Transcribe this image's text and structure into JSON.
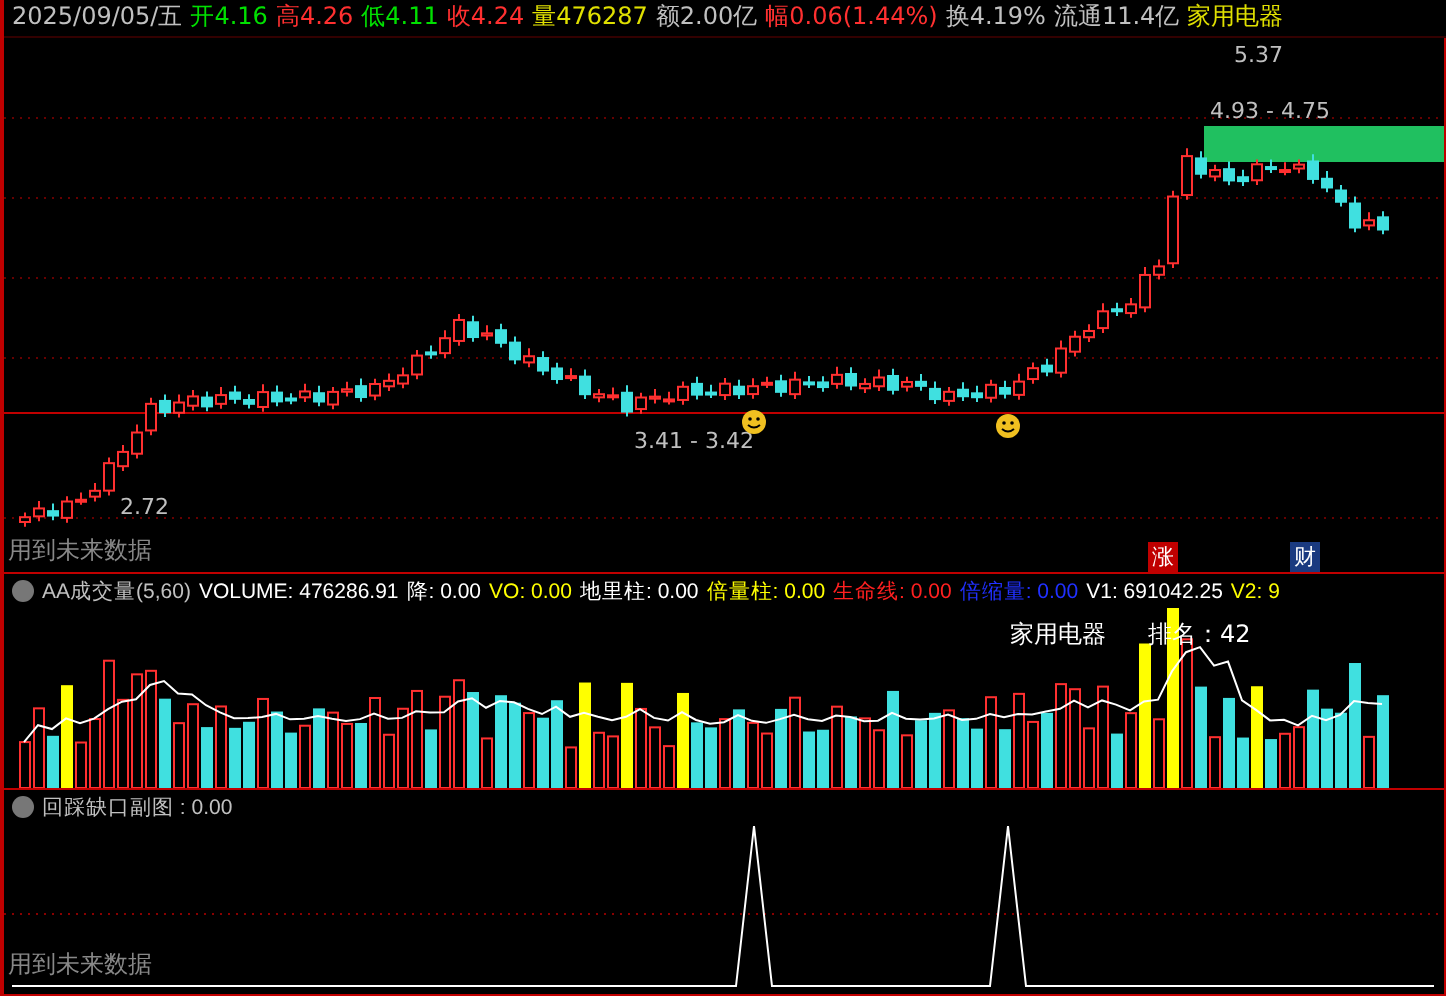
{
  "header": {
    "date": "2025/09/05/五",
    "fields": [
      {
        "label": "开",
        "value": "4.16",
        "color": "#00e000"
      },
      {
        "label": "高",
        "value": "4.26",
        "color": "#ff3030"
      },
      {
        "label": "低",
        "value": "4.11",
        "color": "#00e000"
      },
      {
        "label": "收",
        "value": "4.24",
        "color": "#ff3030"
      },
      {
        "label": "量",
        "value": "476287",
        "color": "#e0e000"
      },
      {
        "label": "额",
        "value": "2.00亿",
        "color": "#c0c0c0"
      },
      {
        "label": "幅",
        "value": "0.06(1.44%)",
        "color": "#ff3030"
      },
      {
        "label": "换",
        "value": "4.19%",
        "color": "#c0c0c0"
      },
      {
        "label": "流通",
        "value": "11.4亿",
        "color": "#c0c0c0"
      }
    ],
    "sector": "家用电器"
  },
  "main_chart": {
    "high_label": "5.37",
    "zone_label": "4.93 - 4.75",
    "support_label": "3.41 - 3.42",
    "low_label": "2.72",
    "watermark": "用到未来数据",
    "markers": [
      {
        "label": "涨",
        "color": "#c00000"
      },
      {
        "label": "财",
        "color": "#1a3a80"
      }
    ]
  },
  "volume_panel": {
    "title": "AA成交量(5,60)",
    "fields": [
      {
        "text": "VOLUME: 476286.91",
        "color": "#ffffff"
      },
      {
        "text": "降: 0.00",
        "color": "#ffffff"
      },
      {
        "text": "VO: 0.00",
        "color": "#ffff00"
      },
      {
        "text": "地里柱: 0.00",
        "color": "#ffffff"
      },
      {
        "text": "倍量柱: 0.00",
        "color": "#ffff00"
      },
      {
        "text": "生命线: 0.00",
        "color": "#ff2020"
      },
      {
        "text": "倍缩量: 0.00",
        "color": "#2030ff"
      },
      {
        "text": "V1: 691042.25",
        "color": "#ffffff"
      },
      {
        "text": "V2: 9",
        "color": "#ffff00"
      }
    ],
    "sector": "家用电器",
    "rank": "排名：42"
  },
  "gap_panel": {
    "title": "回踩缺口副图 : 0.00",
    "watermark": "用到未来数据"
  }
}
